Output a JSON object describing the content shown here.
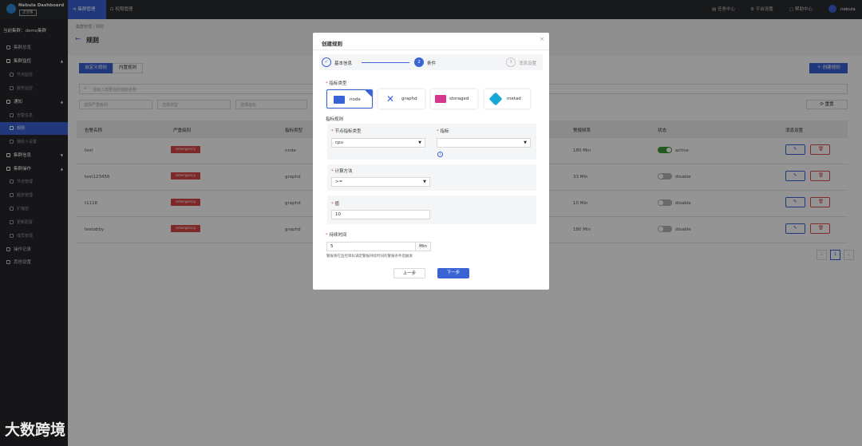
{
  "topbar": {
    "app_title": "Nebula Dashboard",
    "edition_badge": "企业版",
    "nav_cluster": "集群管理",
    "nav_permission": "权限管理",
    "task_center": "任务中心",
    "platform_settings": "平台设置",
    "help_center": "帮助中心",
    "username": "nebula"
  },
  "sidebar": {
    "current_cluster": "当前集群：demo集群",
    "items": [
      {
        "label": "集群总览"
      },
      {
        "label": "集群监控"
      },
      {
        "label": "节点监控"
      },
      {
        "label": "服务监控"
      },
      {
        "label": "通知"
      },
      {
        "label": "告警信息"
      },
      {
        "label": "规则"
      },
      {
        "label": "接收人设置"
      },
      {
        "label": "集群信息"
      },
      {
        "label": "集群操作"
      },
      {
        "label": "节点管理"
      },
      {
        "label": "服务管理"
      },
      {
        "label": "扩缩容"
      },
      {
        "label": "更新配置"
      },
      {
        "label": "成员管理"
      },
      {
        "label": "操作记录"
      },
      {
        "label": "其他设置"
      }
    ]
  },
  "page": {
    "breadcrumb_1": "集群管理",
    "breadcrumb_sep": "/",
    "breadcrumb_2": "规则",
    "title": "规则",
    "tab_custom": "自定义规则",
    "tab_builtin": "内置规则",
    "create_button": "创建规则",
    "search_placeholder": "请输入需要找的指标名称",
    "filter_severity": "选择严重级别",
    "filter_type": "选择类型",
    "filter_metric": "选择指标",
    "reset_button": "重置",
    "columns": [
      "告警名称",
      "严重级别",
      "指标类型",
      "警报频率",
      "状态",
      "消息设置"
    ],
    "rows": [
      {
        "name": "test",
        "severity": "emergency",
        "type": "node",
        "freq": "180 Min",
        "status": "active"
      },
      {
        "name": "test123456",
        "severity": "emergency",
        "type": "graphd",
        "freq": "33 Min",
        "status": "disable"
      },
      {
        "name": "t1118",
        "severity": "emergency",
        "type": "graphd",
        "freq": "10 Min",
        "status": "disable"
      },
      {
        "name": "testabby",
        "severity": "emergency",
        "type": "graphd",
        "freq": "180 Min",
        "status": "disable"
      }
    ],
    "page_number": "1"
  },
  "modal": {
    "title": "创建规则",
    "steps": [
      {
        "num": "✓",
        "label": "基本信息"
      },
      {
        "num": "2",
        "label": "条件"
      },
      {
        "num": "3",
        "label": "消息设置"
      }
    ],
    "metric_type_label": "指标类型",
    "types": [
      {
        "label": "node"
      },
      {
        "label": "graphd"
      },
      {
        "label": "storaged"
      },
      {
        "label": "metad"
      }
    ],
    "metric_rule_label": "指标规则",
    "node_metric_type_label": "节点指标类型",
    "node_metric_type_value": "cpu",
    "metric_label": "指标",
    "metric_value": "",
    "calc_method_label": "计算方法",
    "calc_method_value": ">=",
    "value_label": "值",
    "value_value": "10",
    "duration_label": "持续时间",
    "duration_value": "5",
    "duration_unit": "Min",
    "duration_hint": "警报将在监控目标满足警报持续时间的警报条件后触发",
    "prev_button": "上一步",
    "next_button": "下一步"
  },
  "watermark": "大数跨境",
  "colors": {
    "primary": "#3a63d6",
    "danger": "#d94848",
    "active": "#3a9a3a"
  }
}
